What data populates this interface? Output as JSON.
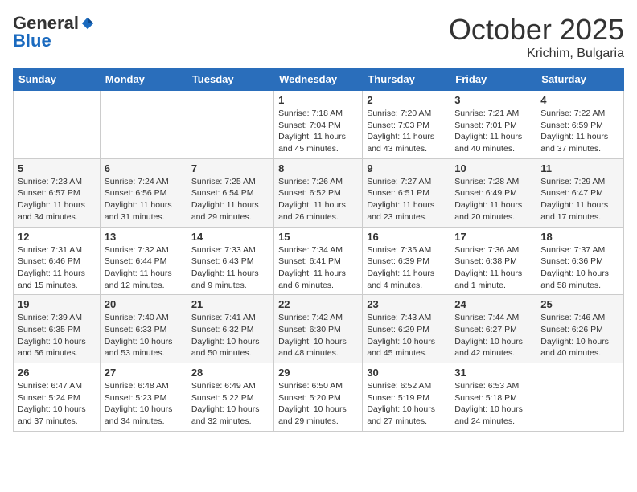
{
  "header": {
    "logo": {
      "general": "General",
      "blue": "Blue"
    },
    "title": "October 2025",
    "location": "Krichim, Bulgaria"
  },
  "weekdays": [
    "Sunday",
    "Monday",
    "Tuesday",
    "Wednesday",
    "Thursday",
    "Friday",
    "Saturday"
  ],
  "weeks": [
    [
      {
        "day": "",
        "info": ""
      },
      {
        "day": "",
        "info": ""
      },
      {
        "day": "",
        "info": ""
      },
      {
        "day": "1",
        "info": "Sunrise: 7:18 AM\nSunset: 7:04 PM\nDaylight: 11 hours and 45 minutes."
      },
      {
        "day": "2",
        "info": "Sunrise: 7:20 AM\nSunset: 7:03 PM\nDaylight: 11 hours and 43 minutes."
      },
      {
        "day": "3",
        "info": "Sunrise: 7:21 AM\nSunset: 7:01 PM\nDaylight: 11 hours and 40 minutes."
      },
      {
        "day": "4",
        "info": "Sunrise: 7:22 AM\nSunset: 6:59 PM\nDaylight: 11 hours and 37 minutes."
      }
    ],
    [
      {
        "day": "5",
        "info": "Sunrise: 7:23 AM\nSunset: 6:57 PM\nDaylight: 11 hours and 34 minutes."
      },
      {
        "day": "6",
        "info": "Sunrise: 7:24 AM\nSunset: 6:56 PM\nDaylight: 11 hours and 31 minutes."
      },
      {
        "day": "7",
        "info": "Sunrise: 7:25 AM\nSunset: 6:54 PM\nDaylight: 11 hours and 29 minutes."
      },
      {
        "day": "8",
        "info": "Sunrise: 7:26 AM\nSunset: 6:52 PM\nDaylight: 11 hours and 26 minutes."
      },
      {
        "day": "9",
        "info": "Sunrise: 7:27 AM\nSunset: 6:51 PM\nDaylight: 11 hours and 23 minutes."
      },
      {
        "day": "10",
        "info": "Sunrise: 7:28 AM\nSunset: 6:49 PM\nDaylight: 11 hours and 20 minutes."
      },
      {
        "day": "11",
        "info": "Sunrise: 7:29 AM\nSunset: 6:47 PM\nDaylight: 11 hours and 17 minutes."
      }
    ],
    [
      {
        "day": "12",
        "info": "Sunrise: 7:31 AM\nSunset: 6:46 PM\nDaylight: 11 hours and 15 minutes."
      },
      {
        "day": "13",
        "info": "Sunrise: 7:32 AM\nSunset: 6:44 PM\nDaylight: 11 hours and 12 minutes."
      },
      {
        "day": "14",
        "info": "Sunrise: 7:33 AM\nSunset: 6:43 PM\nDaylight: 11 hours and 9 minutes."
      },
      {
        "day": "15",
        "info": "Sunrise: 7:34 AM\nSunset: 6:41 PM\nDaylight: 11 hours and 6 minutes."
      },
      {
        "day": "16",
        "info": "Sunrise: 7:35 AM\nSunset: 6:39 PM\nDaylight: 11 hours and 4 minutes."
      },
      {
        "day": "17",
        "info": "Sunrise: 7:36 AM\nSunset: 6:38 PM\nDaylight: 11 hours and 1 minute."
      },
      {
        "day": "18",
        "info": "Sunrise: 7:37 AM\nSunset: 6:36 PM\nDaylight: 10 hours and 58 minutes."
      }
    ],
    [
      {
        "day": "19",
        "info": "Sunrise: 7:39 AM\nSunset: 6:35 PM\nDaylight: 10 hours and 56 minutes."
      },
      {
        "day": "20",
        "info": "Sunrise: 7:40 AM\nSunset: 6:33 PM\nDaylight: 10 hours and 53 minutes."
      },
      {
        "day": "21",
        "info": "Sunrise: 7:41 AM\nSunset: 6:32 PM\nDaylight: 10 hours and 50 minutes."
      },
      {
        "day": "22",
        "info": "Sunrise: 7:42 AM\nSunset: 6:30 PM\nDaylight: 10 hours and 48 minutes."
      },
      {
        "day": "23",
        "info": "Sunrise: 7:43 AM\nSunset: 6:29 PM\nDaylight: 10 hours and 45 minutes."
      },
      {
        "day": "24",
        "info": "Sunrise: 7:44 AM\nSunset: 6:27 PM\nDaylight: 10 hours and 42 minutes."
      },
      {
        "day": "25",
        "info": "Sunrise: 7:46 AM\nSunset: 6:26 PM\nDaylight: 10 hours and 40 minutes."
      }
    ],
    [
      {
        "day": "26",
        "info": "Sunrise: 6:47 AM\nSunset: 5:24 PM\nDaylight: 10 hours and 37 minutes."
      },
      {
        "day": "27",
        "info": "Sunrise: 6:48 AM\nSunset: 5:23 PM\nDaylight: 10 hours and 34 minutes."
      },
      {
        "day": "28",
        "info": "Sunrise: 6:49 AM\nSunset: 5:22 PM\nDaylight: 10 hours and 32 minutes."
      },
      {
        "day": "29",
        "info": "Sunrise: 6:50 AM\nSunset: 5:20 PM\nDaylight: 10 hours and 29 minutes."
      },
      {
        "day": "30",
        "info": "Sunrise: 6:52 AM\nSunset: 5:19 PM\nDaylight: 10 hours and 27 minutes."
      },
      {
        "day": "31",
        "info": "Sunrise: 6:53 AM\nSunset: 5:18 PM\nDaylight: 10 hours and 24 minutes."
      },
      {
        "day": "",
        "info": ""
      }
    ]
  ]
}
